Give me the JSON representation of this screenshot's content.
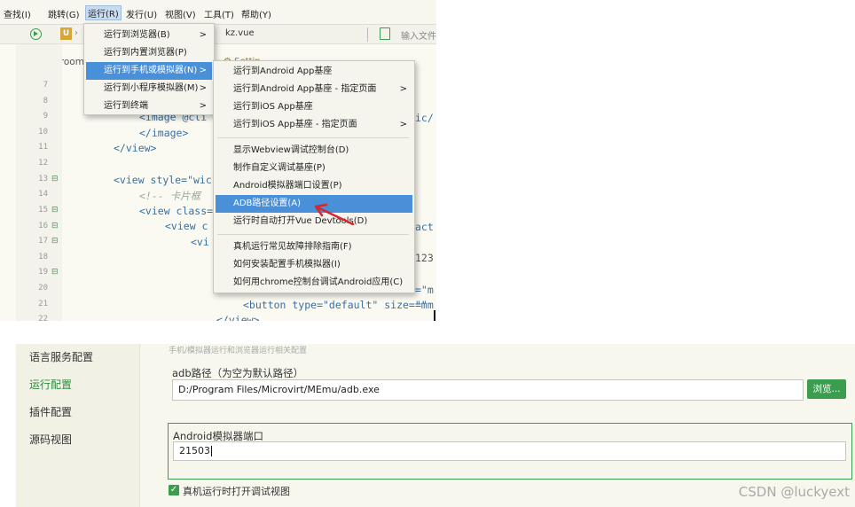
{
  "menubar": {
    "items": [
      "查找(I)",
      "跳转(G)",
      "运行(R)",
      "发行(U)",
      "视图(V)",
      "工具(T)",
      "帮助(Y)"
    ]
  },
  "tabbar": {
    "file_label": "kz.vue",
    "input_placeholder": "输入文件",
    "u_badge": "U"
  },
  "editor": {
    "breadcrumb": "addroom",
    "partial_settings": "Settin",
    "line_numbers": [
      "7",
      "8",
      "9",
      "10",
      "11",
      "12",
      "13",
      "14",
      "15",
      "16",
      "17",
      "18",
      "19",
      "20",
      "21",
      "22"
    ],
    "lines": [
      "<image @cli",
      "</image>",
      "</view>",
      "",
      "<view style=\"wic",
      "<!-- 卡片框",
      "<view class=",
      "<view c",
      "<vi",
      "",
      "",
      "",
      "<button type=\"default\" size=\"m"
    ],
    "right_fragments": [
      "ic/",
      "act",
      "123",
      "=\"m",
      "=\"m"
    ],
    "last_line": "</view>"
  },
  "run_menu": {
    "items": [
      {
        "label": "运行到浏览器(B)",
        "submenu": true
      },
      {
        "label": "运行到内置浏览器(P)",
        "submenu": false
      },
      {
        "label": "运行到手机或模拟器(N)",
        "submenu": true
      },
      {
        "label": "运行到小程序模拟器(M)",
        "submenu": true
      },
      {
        "label": "运行到终端",
        "submenu": true
      }
    ]
  },
  "sub_menu": {
    "items": [
      {
        "label": "运行到Android App基座",
        "submenu": false
      },
      {
        "label": "运行到Android App基座 - 指定页面",
        "submenu": true
      },
      {
        "label": "运行到iOS App基座",
        "submenu": false
      },
      {
        "label": "运行到iOS App基座 - 指定页面",
        "submenu": true
      },
      {
        "label": "显示Webview调试控制台(D)",
        "submenu": false
      },
      {
        "label": "制作自定义调试基座(P)",
        "submenu": false
      },
      {
        "label": "Android模拟器端口设置(P)",
        "submenu": false
      },
      {
        "label": "ADB路径设置(A)",
        "submenu": false
      },
      {
        "label": "运行时自动打开Vue Devtools(D)",
        "submenu": false
      },
      {
        "label": "真机运行常见故障排除指南(F)",
        "submenu": false
      },
      {
        "label": "如何安装配置手机模拟器(I)",
        "submenu": false
      },
      {
        "label": "如何用chrome控制台调试Android应用(C)",
        "submenu": false
      }
    ]
  },
  "settings": {
    "sidebar": [
      "语言服务配置",
      "运行配置",
      "插件配置",
      "源码视图"
    ],
    "active_index": 1,
    "section_hint": "手机/模拟器运行和浏览器运行相关配置",
    "adb_label": "adb路径（为空为默认路径）",
    "adb_value": "D:/Program Files/Microvirt/MEmu/adb.exe",
    "browse_label": "浏览...",
    "port_label": "Android模拟器端口",
    "port_value": "21503",
    "checkbox_label": "真机运行时打开调试视图",
    "checkbox_checked": true
  },
  "watermark": "CSDN @luckyext",
  "colors": {
    "accent": "#3b9d4e",
    "highlight": "#4a90d9",
    "arrow": "#d9262c"
  }
}
